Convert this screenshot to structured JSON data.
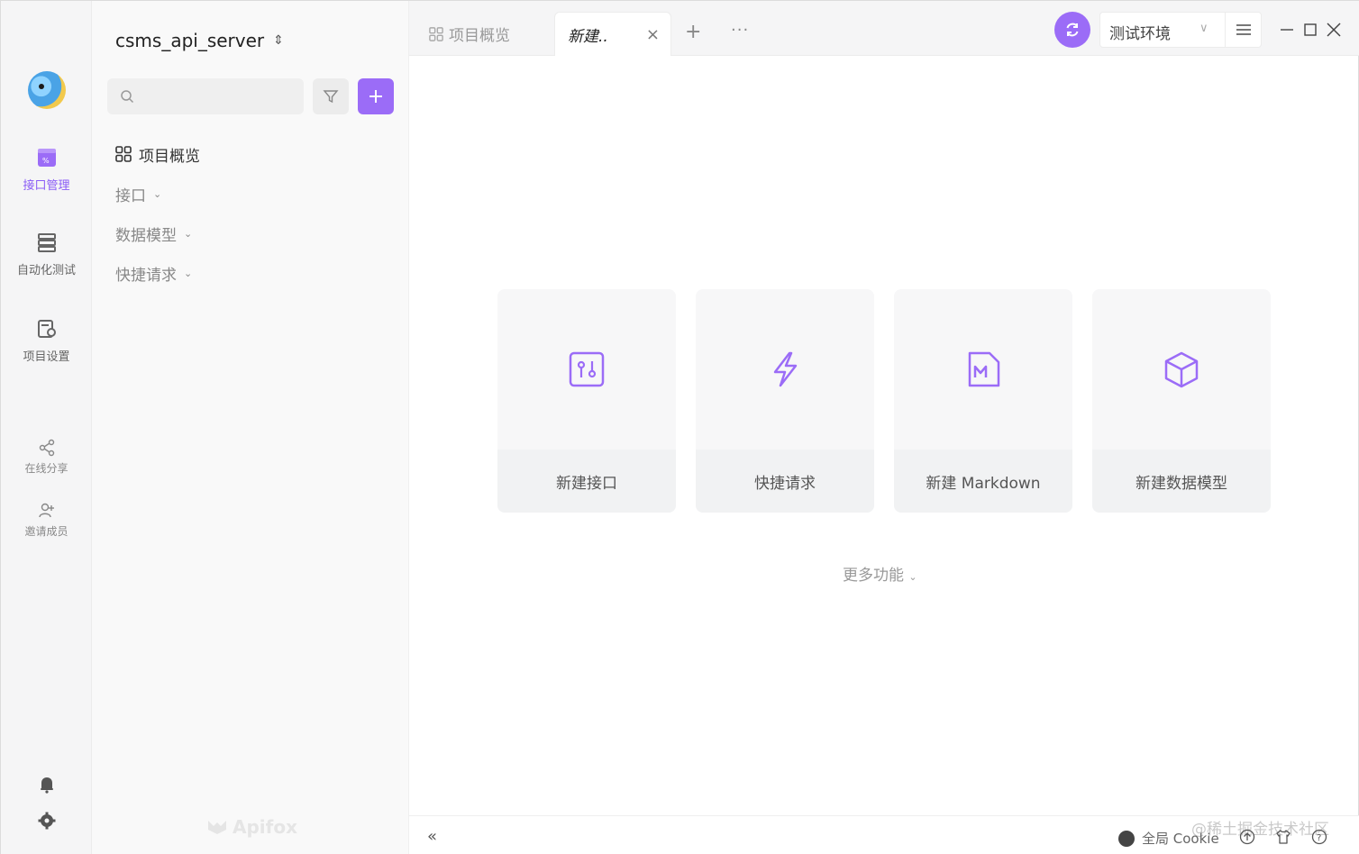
{
  "rail": {
    "items": [
      {
        "label": "接口管理",
        "icon": "api-icon",
        "active": true
      },
      {
        "label": "自动化测试",
        "icon": "server-icon"
      },
      {
        "label": "项目设置",
        "icon": "settings-doc-icon"
      }
    ],
    "share_label": "在线分享",
    "invite_label": "邀请成员"
  },
  "sidebar": {
    "project_name": "csms_api_server",
    "search_placeholder": "",
    "tree": [
      {
        "label": "项目概览"
      },
      {
        "label": "接口"
      },
      {
        "label": "数据模型"
      },
      {
        "label": "快捷请求"
      }
    ],
    "brand": "Apifox"
  },
  "tabs": {
    "items": [
      {
        "label": "项目概览"
      },
      {
        "label": "新建.."
      }
    ],
    "close_glyph": "×",
    "plus_glyph": "+",
    "more_glyph": "···"
  },
  "env": {
    "selected": "测试环境"
  },
  "main": {
    "cards": [
      {
        "label": "新建接口",
        "icon": "api-icon"
      },
      {
        "label": "快捷请求",
        "icon": "lightning-icon"
      },
      {
        "label": "新建 Markdown",
        "icon": "markdown-file-icon"
      },
      {
        "label": "新建数据模型",
        "icon": "cube-icon"
      }
    ],
    "more": "更多功能"
  },
  "bottom": {
    "cookie_label": "全局 Cookie",
    "watermark": "@稀土掘金技术社区"
  },
  "colors": {
    "accent": "#9b6cf7"
  }
}
